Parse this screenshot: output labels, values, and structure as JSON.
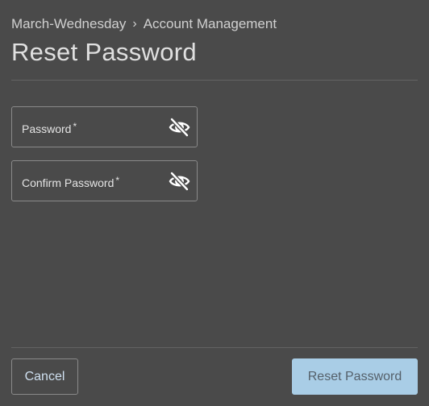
{
  "breadcrumb": {
    "items": [
      "March-Wednesday",
      "Account Management"
    ],
    "separator": "›"
  },
  "title": "Reset Password",
  "fields": [
    {
      "label": "Password",
      "required_mark": "*",
      "value": "",
      "visibility_icon": "eye-slash-icon"
    },
    {
      "label": "Confirm Password",
      "required_mark": "*",
      "value": "",
      "visibility_icon": "eye-slash-icon"
    }
  ],
  "footer": {
    "cancel_label": "Cancel",
    "submit_label": "Reset Password"
  },
  "colors": {
    "background": "#4a4a4a",
    "primary_button": "#a9cde6",
    "link_text": "#cfe0f0"
  }
}
